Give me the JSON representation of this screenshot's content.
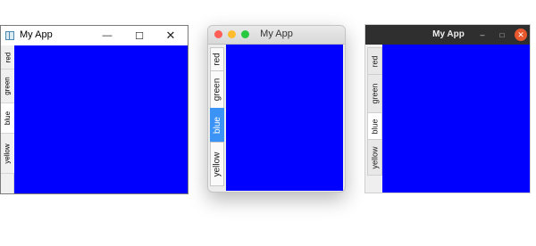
{
  "colors": {
    "panel": "#0000ff"
  },
  "windows": [
    {
      "platform": "windows",
      "title": "My App",
      "controls": {
        "minimize_icon": "minimize-icon",
        "maximize_icon": "maximize-icon",
        "close_icon": "close-icon"
      },
      "tabs": [
        {
          "label": "red",
          "selected": false
        },
        {
          "label": "green",
          "selected": false
        },
        {
          "label": "blue",
          "selected": true
        },
        {
          "label": "yellow",
          "selected": false
        }
      ]
    },
    {
      "platform": "macos",
      "title": "My App",
      "traffic_lights": [
        "#ff5f57",
        "#febc2e",
        "#28c840"
      ],
      "tabs": [
        {
          "label": "red",
          "selected": false
        },
        {
          "label": "green",
          "selected": false
        },
        {
          "label": "blue",
          "selected": true
        },
        {
          "label": "yellow",
          "selected": false
        }
      ]
    },
    {
      "platform": "ubuntu",
      "title": "My App",
      "tabs": [
        {
          "label": "red",
          "selected": false
        },
        {
          "label": "green",
          "selected": false
        },
        {
          "label": "blue",
          "selected": true
        },
        {
          "label": "yellow",
          "selected": false
        }
      ]
    }
  ]
}
